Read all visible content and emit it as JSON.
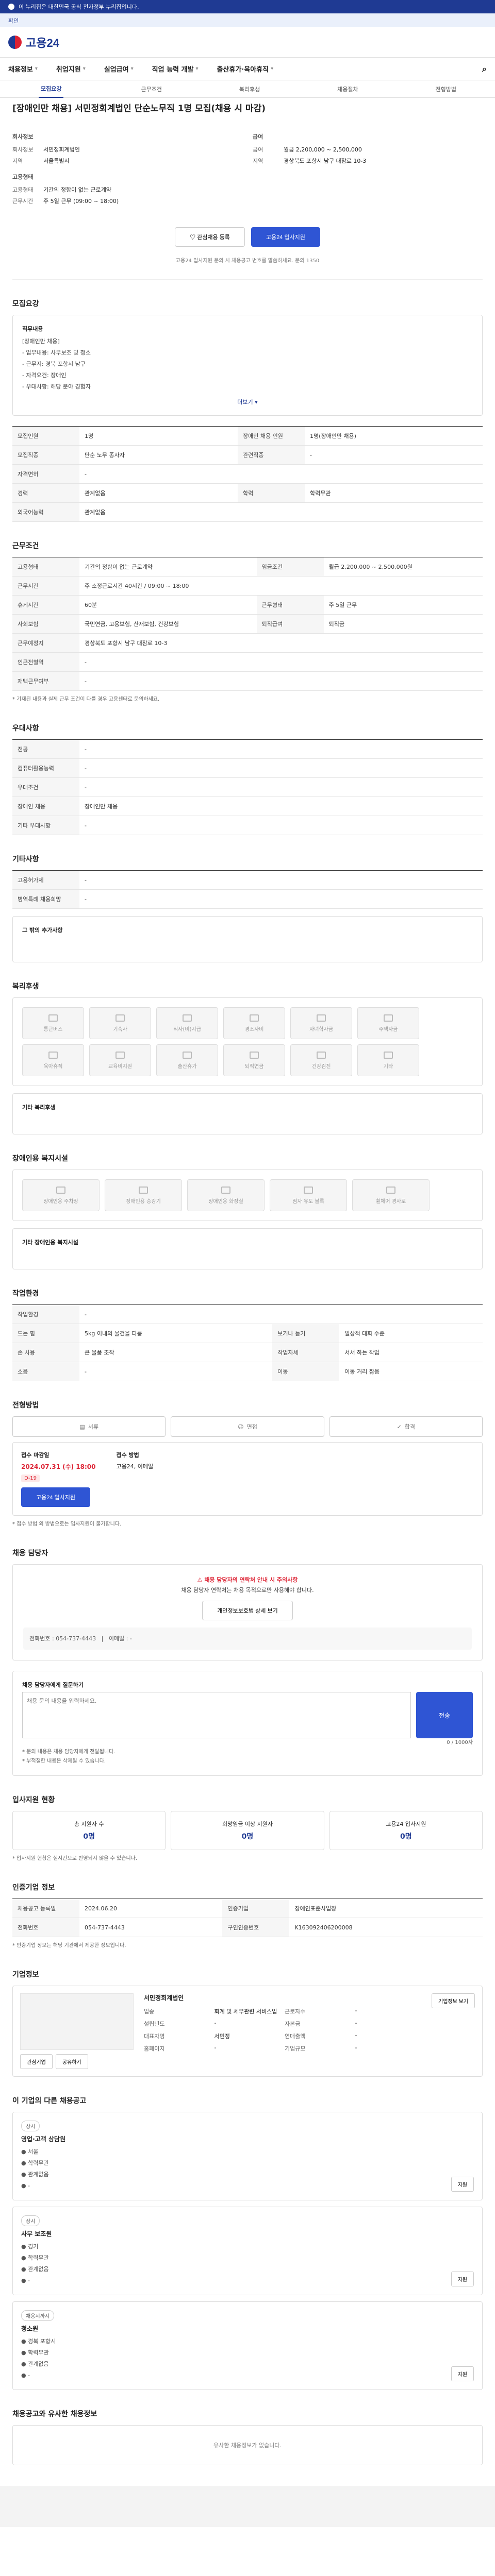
{
  "banner": {
    "text": "이 누리집은 대한민국 공식 전자정부 누리집입니다.",
    "toggle": "확인"
  },
  "brand": {
    "name": "고용24"
  },
  "gnb": [
    "채용정보",
    "취업지원",
    "실업급여",
    "직업 능력 개발",
    "출산휴가·육아휴직"
  ],
  "tabs": [
    "모집요강",
    "근무조건",
    "복리후생",
    "채용절차",
    "전형방법"
  ],
  "job": {
    "title": "[장애인만 채용] 서민정회계법인 단순노무직 1명 모집(채용 시 마감)",
    "company_label": "회사정보",
    "company": "서민정회계법인",
    "region_label": "지역",
    "region": "서울특별시",
    "wage_label": "급여",
    "wage": "월급 2,200,000 ~ 2,500,000",
    "location_label": "지역",
    "location": "경상북도 포항시 남구 대잠로 10-3",
    "type_label": "고용형태",
    "type": "기간의 정함이 없는 근로계약",
    "work_label": "근무시간",
    "work": "주 5일 근무 (09:00 ~ 18:00)",
    "scrap": "관심채용 등록",
    "apply": "고용24 입사지원",
    "notice": "고용24 입사지원 문의 시 채용공고 번호를 말씀하세요. 문의 1350"
  },
  "sections": {
    "recruit": "모집요강",
    "conditions": "근무조건",
    "lang": "우대사항",
    "other": "기타사항",
    "welfare": "복리후생",
    "disability": "장애인용 복지시설",
    "env": "작업환경",
    "process": "전형방법",
    "contact": "채용 담당자",
    "status": "입사지원 현황",
    "company": "인증기업 정보",
    "corp": "기업정보",
    "otherjobs": "이 기업의 다른 채용공고",
    "related": "채용공고와 유사한 채용정보"
  },
  "recruit": {
    "label": "직무내용",
    "items": [
      "[장애인만 채용]",
      "- 업무내용: 사무보조 및 청소",
      "- 근무지: 경북 포항시 남구",
      "- 자격요건: 장애인",
      "- 우대사항: 해당 분야 경험자"
    ],
    "more": "더보기",
    "rows": [
      [
        "모집인원",
        "1명",
        "장애인 채용 인원",
        "1명(장애인만 채용)"
      ],
      [
        "모집직종",
        "단순 노무 종사자",
        "관련직종",
        "-"
      ],
      [
        "자격면허",
        "-",
        "",
        ""
      ],
      [
        "경력",
        "관계없음",
        "학력",
        "학력무관"
      ],
      [
        "외국어능력",
        "관계없음",
        "",
        ""
      ]
    ]
  },
  "conditions": {
    "rows": [
      [
        "고용형태",
        "기간의 정함이 없는 근로계약",
        "임금조건",
        "월급 2,200,000 ~ 2,500,000원"
      ],
      [
        "근무시간",
        "주 소정근로시간 40시간 / 09:00 ~ 18:00",
        "",
        ""
      ],
      [
        "휴게시간",
        "60분",
        "근무형태",
        "주 5일 근무"
      ],
      [
        "사회보험",
        "국민연금, 고용보험, 산재보험, 건강보험",
        "퇴직급여",
        "퇴직금"
      ],
      [
        "근무예정지",
        "경상북도 포항시 남구 대잠로 10-3",
        "",
        ""
      ],
      [
        "인근전철역",
        "-",
        "",
        ""
      ],
      [
        "재택근무여부",
        "-",
        "",
        ""
      ]
    ],
    "note": "* 기재된 내용과 실제 근무 조건이 다를 경우 고용센터로 문의하세요."
  },
  "lang": {
    "rows": [
      [
        "전공",
        "-"
      ],
      [
        "컴퓨터활용능력",
        "-"
      ],
      [
        "우대조건",
        "-"
      ],
      [
        "장애인 채용",
        "장애인만 채용"
      ],
      [
        "기타 우대사항",
        "-"
      ]
    ]
  },
  "other": {
    "rows": [
      [
        "고용허가제",
        "-"
      ],
      [
        "병역특례 채용희망",
        "-"
      ]
    ],
    "extra_label": "그 밖의 추가사항"
  },
  "welfare": {
    "items": [
      "통근버스",
      "기숙사",
      "식사(비)지급",
      "경조사비",
      "자녀학자금",
      "주택자금",
      "육아휴직",
      "교육비지원",
      "출산휴가",
      "퇴직연금",
      "건강검진",
      "기타"
    ],
    "extra_label": "기타 복리후생"
  },
  "disability": {
    "items": [
      "장애인용 주차장",
      "장애인용 승강기",
      "장애인용 화장실",
      "점자 유도 블록",
      "휠체어 경사로"
    ],
    "extra_label": "기타 장애인용 복지시설"
  },
  "env": {
    "rows": [
      [
        "작업환경",
        "-",
        "",
        ""
      ],
      [
        "드는 힘",
        "5kg 이내의 물건을 다룸",
        "보거나 듣기",
        "일상적 대화 수준"
      ],
      [
        "손 사용",
        "큰 물품 조작",
        "작업자세",
        "서서 하는 작업"
      ],
      [
        "소음",
        "-",
        "이동",
        "이동 거리 짧음"
      ]
    ]
  },
  "process": {
    "steps": [
      "서류",
      "면접",
      "합격"
    ],
    "period_label": "접수 마감일",
    "period": "2024.07.31 (수) 18:00",
    "dday": "D-19",
    "doc_label": "접수 방법",
    "docs": "고용24, 이메일",
    "apply": "고용24 입사지원",
    "note": "* 접수 방법 외 방법으로는 입사지원이 불가합니다."
  },
  "contact": {
    "warn": "채용 담당자의 연락처 안내 시 주의사항",
    "msg": "채용 담당자 연락처는 채용 목적으로만 사용해야 합니다.",
    "btn": "개인정보보호법 상세 보기",
    "phone_label": "전화번호",
    "phone": "054-737-4443",
    "email_label": "이메일",
    "email": "-"
  },
  "inquiry": {
    "label": "채용 담당자에게 질문하기",
    "placeholder": "채용 문의 내용을 입력하세요.",
    "send": "전송",
    "count": "0 / 1000자",
    "notes": [
      "* 문의 내용은 채용 담당자에게 전달됩니다.",
      "* 부적절한 내용은 삭제될 수 있습니다."
    ]
  },
  "status": {
    "items": [
      [
        "총 지원자 수",
        "0명"
      ],
      [
        "희망임금 이상 지원자",
        "0명"
      ],
      [
        "고용24 입사지원",
        "0명"
      ]
    ],
    "note": "* 입사지원 현황은 실시간으로 반영되지 않을 수 있습니다."
  },
  "company_info": {
    "rows": [
      [
        "채용공고 등록일",
        "2024.06.20",
        "인증기업",
        "장애인표준사업장"
      ],
      [
        "전화번호",
        "054-737-4443",
        "구인인증번호",
        "K163092406200008"
      ]
    ],
    "note": "* 인증기업 정보는 해당 기관에서 제공한 정보입니다."
  },
  "corp": {
    "name": "서민정회계법인",
    "fields": [
      [
        "업종",
        "회계 및 세무관련 서비스업"
      ],
      [
        "근로자수",
        "-"
      ],
      [
        "설립년도",
        "-"
      ],
      [
        "자본금",
        "-"
      ],
      [
        "대표자명",
        "서민정"
      ],
      [
        "연매출액",
        "-"
      ],
      [
        "홈페이지",
        "-"
      ],
      [
        "기업규모",
        "-"
      ]
    ],
    "btns": [
      "기업정보 보기",
      "관심기업",
      "공유하기"
    ]
  },
  "otherjobs": [
    {
      "tag": "상시",
      "title": "영업·고객 상담원",
      "meta": [
        "서울",
        "학력무관",
        "관계없음",
        "-"
      ]
    },
    {
      "tag": "상시",
      "title": "사무 보조원",
      "meta": [
        "경기",
        "학력무관",
        "관계없음",
        "-"
      ]
    },
    {
      "tag": "채용시까지",
      "title": "청소원",
      "meta": [
        "경북 포항시",
        "학력무관",
        "관계없음",
        "-"
      ]
    }
  ],
  "otherjobs_btn": "지원",
  "related": {
    "empty": "유사한 채용정보가 없습니다."
  }
}
